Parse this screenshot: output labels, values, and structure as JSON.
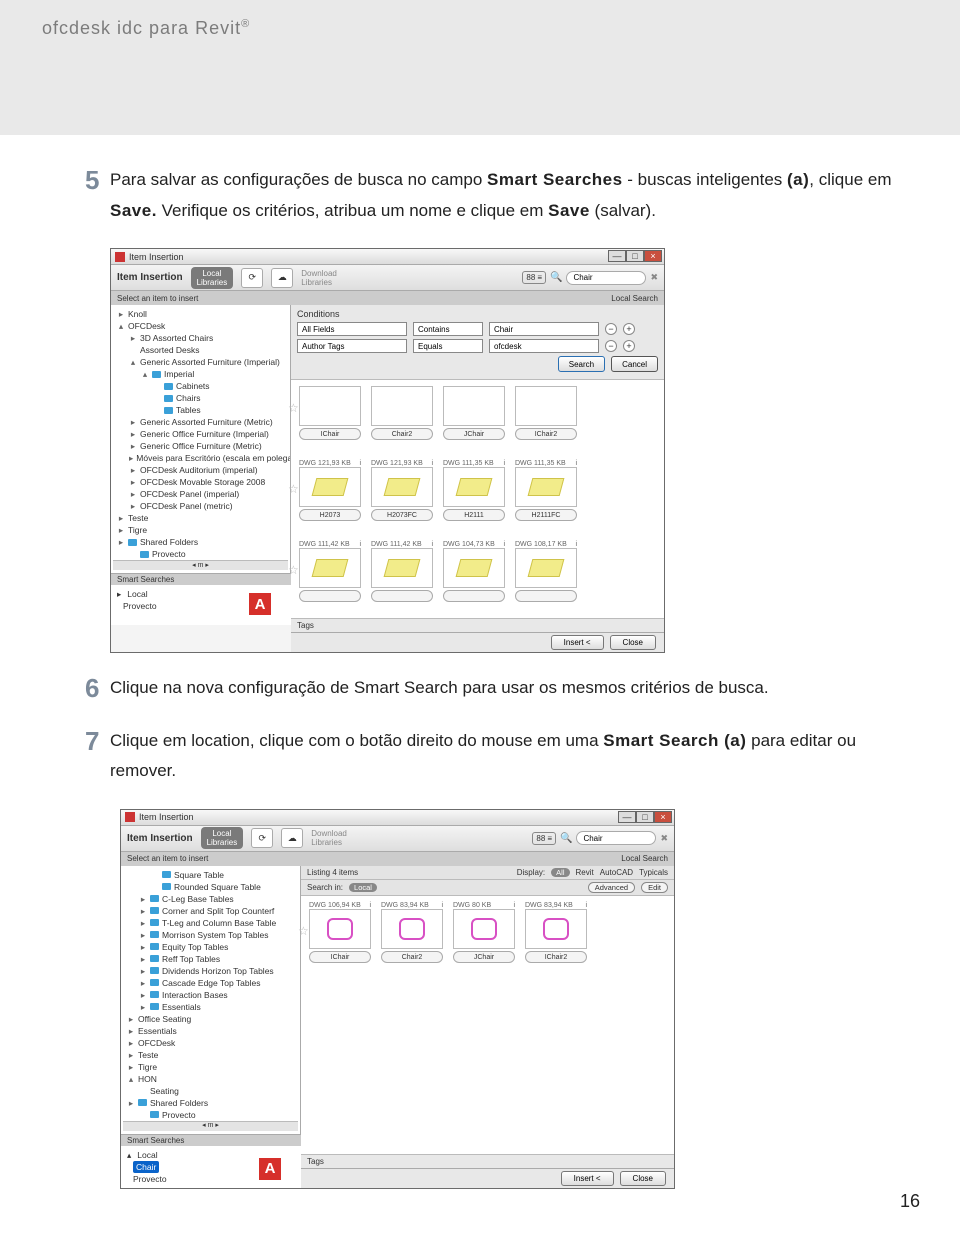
{
  "header": {
    "title": "ofcdesk idc para Revit",
    "reg": "®"
  },
  "page_number": "16",
  "steps": {
    "s5": {
      "num": "5",
      "p1a": "Para salvar as configurações de busca no campo ",
      "p1b": "Smart Searches",
      "p1c": " - buscas inteligentes ",
      "p1d": "(a)",
      "p1e": ", clique em ",
      "p1f": "Save.",
      "p1g": " Verifique os critérios, atribua um nome e clique em ",
      "p1h": "Save",
      "p1i": " (salvar)."
    },
    "s6": {
      "num": "6",
      "text": "Clique na nova configuração de Smart Search para usar os mesmos critérios de busca."
    },
    "s7": {
      "num": "7",
      "p1a": "Clique em location, clique com o botão direito do mouse em uma ",
      "p1b": "Smart Search (a)",
      "p1c": " para editar ou remover."
    }
  },
  "app1": {
    "window_title": "Item Insertion",
    "ribbon_title": "Item Insertion",
    "local_libraries": "Local\nLibraries",
    "download_libraries": "Download\nLibraries",
    "toggle": "88",
    "search_value": "Chair",
    "subbar_left": "Select an item to insert",
    "subbar_right": "Local Search",
    "tree": [
      {
        "ind": 0,
        "arrow": "▸",
        "label": "Knoll"
      },
      {
        "ind": 0,
        "arrow": "▴",
        "label": "OFCDesk"
      },
      {
        "ind": 1,
        "arrow": "▸",
        "label": "3D Assorted Chairs"
      },
      {
        "ind": 1,
        "arrow": "",
        "label": "Assorted Desks"
      },
      {
        "ind": 1,
        "arrow": "▴",
        "label": "Generic Assorted Furniture (Imperial)"
      },
      {
        "ind": 2,
        "arrow": "▴",
        "folder": true,
        "label": "Imperial"
      },
      {
        "ind": 3,
        "arrow": "",
        "folder": true,
        "label": "Cabinets"
      },
      {
        "ind": 3,
        "arrow": "",
        "folder": true,
        "label": "Chairs"
      },
      {
        "ind": 3,
        "arrow": "",
        "folder": true,
        "label": "Tables"
      },
      {
        "ind": 1,
        "arrow": "▸",
        "label": "Generic Assorted Furniture (Metric)"
      },
      {
        "ind": 1,
        "arrow": "▸",
        "label": "Generic Office Furniture (Imperial)"
      },
      {
        "ind": 1,
        "arrow": "▸",
        "label": "Generic Office Furniture (Metric)"
      },
      {
        "ind": 1,
        "arrow": "▸",
        "label": "Móveis para Escritório (escala em polega"
      },
      {
        "ind": 1,
        "arrow": "▸",
        "label": "OFCDesk Auditorium (imperial)"
      },
      {
        "ind": 1,
        "arrow": "▸",
        "label": "OFCDesk Movable Storage 2008"
      },
      {
        "ind": 1,
        "arrow": "▸",
        "label": "OFCDesk Panel (imperial)"
      },
      {
        "ind": 1,
        "arrow": "▸",
        "label": "OFCDesk Panel (metric)"
      },
      {
        "ind": 0,
        "arrow": "▸",
        "label": "Teste"
      },
      {
        "ind": 0,
        "arrow": "▸",
        "label": "Tigre"
      },
      {
        "ind": 0,
        "arrow": "▸",
        "folder": true,
        "label": "Shared Folders"
      },
      {
        "ind": 1,
        "arrow": "",
        "folder": true,
        "label": "Provecto"
      }
    ],
    "conditions_title": "Conditions",
    "cond_rows": [
      {
        "field": "All Fields",
        "op": "Contains",
        "val": "Chair"
      },
      {
        "field": "Author Tags",
        "op": "Equals",
        "val": "ofcdesk"
      }
    ],
    "btn_search": "Search",
    "btn_cancel": "Cancel",
    "thumbs_row1": [
      "IChair",
      "Chair2",
      "JChair",
      "IChair2"
    ],
    "thumbs_row2_meta": [
      "DWG 121,93 KB",
      "DWG 121,93 KB",
      "DWG 111,35 KB",
      "DWG 111,35 KB"
    ],
    "thumbs_row2": [
      "H2073",
      "H2073FC",
      "H2111",
      "H2111FC"
    ],
    "thumbs_row3_meta": [
      "DWG 111,42 KB",
      "DWG 111,42 KB",
      "DWG 104,73 KB",
      "DWG 108,17 KB"
    ],
    "smart_hdr": "Smart Searches",
    "smart_rows": [
      {
        "arrow": "▸",
        "folder": true,
        "label": "Local"
      },
      {
        "arrow": "",
        "folder": true,
        "label": "Provecto"
      }
    ],
    "badge": "A",
    "tags": "Tags",
    "btn_insert": "Insert <",
    "btn_close": "Close"
  },
  "app2": {
    "window_title": "Item Insertion",
    "ribbon_title": "Item Insertion",
    "local_libraries": "Local\nLibraries",
    "download_libraries": "Download\nLibraries",
    "toggle": "88",
    "search_value": "Chair",
    "subbar_left": "Select an item to insert",
    "subbar_right": "Local Search",
    "tree": [
      {
        "ind": 2,
        "folder": true,
        "label": "Square Table"
      },
      {
        "ind": 2,
        "folder": true,
        "label": "Rounded Square Table"
      },
      {
        "ind": 1,
        "arrow": "▸",
        "folder": true,
        "label": "C-Leg Base Tables"
      },
      {
        "ind": 1,
        "arrow": "▸",
        "folder": true,
        "label": "Corner and Split Top Counterf"
      },
      {
        "ind": 1,
        "arrow": "▸",
        "folder": true,
        "label": "T-Leg and Column Base Table"
      },
      {
        "ind": 1,
        "arrow": "▸",
        "folder": true,
        "label": "Morrison System Top Tables"
      },
      {
        "ind": 1,
        "arrow": "▸",
        "folder": true,
        "label": "Equity Top Tables"
      },
      {
        "ind": 1,
        "arrow": "▸",
        "folder": true,
        "label": "Reff Top Tables"
      },
      {
        "ind": 1,
        "arrow": "▸",
        "folder": true,
        "label": "Dividends Horizon Top Tables"
      },
      {
        "ind": 1,
        "arrow": "▸",
        "folder": true,
        "label": "Cascade Edge Top Tables"
      },
      {
        "ind": 1,
        "arrow": "▸",
        "folder": true,
        "label": "Interaction Bases"
      },
      {
        "ind": 1,
        "arrow": "▸",
        "folder": true,
        "label": "Essentials"
      },
      {
        "ind": 0,
        "arrow": "▸",
        "label": "Office Seating"
      },
      {
        "ind": 0,
        "arrow": "▸",
        "label": "Essentials"
      },
      {
        "ind": 0,
        "arrow": "▸",
        "label": "OFCDesk"
      },
      {
        "ind": 0,
        "arrow": "▸",
        "label": "Teste"
      },
      {
        "ind": 0,
        "arrow": "▸",
        "label": "Tigre"
      },
      {
        "ind": 0,
        "arrow": "▴",
        "label": "HON"
      },
      {
        "ind": 1,
        "arrow": "",
        "label": "Seating"
      },
      {
        "ind": 0,
        "arrow": "▸",
        "folder": true,
        "label": "Shared Folders"
      },
      {
        "ind": 1,
        "arrow": "",
        "folder": true,
        "label": "Provecto"
      }
    ],
    "listbar_left": "Listing 4 items",
    "display": "Display:",
    "display_opts": [
      "All",
      "Revit",
      "AutoCAD",
      "Typicals"
    ],
    "searchin": "Search in:",
    "searchin_val": "Local",
    "adv": "Advanced",
    "edit": "Edit",
    "thumbs_meta": [
      "DWG 106,94 KB",
      "DWG 83,94 KB",
      "DWG 80 KB",
      "DWG 83,94 KB"
    ],
    "thumbs": [
      "IChair",
      "Chair2",
      "JChair",
      "IChair2"
    ],
    "smart_hdr": "Smart Searches",
    "smart_rows": [
      {
        "arrow": "▴",
        "folder": true,
        "label": "Local"
      },
      {
        "arrow": "",
        "folder": true,
        "label": "Chair",
        "selected": true
      },
      {
        "arrow": "",
        "folder": true,
        "label": "Provecto"
      }
    ],
    "badge": "A",
    "tags": "Tags",
    "btn_insert": "Insert <",
    "btn_close": "Close"
  }
}
